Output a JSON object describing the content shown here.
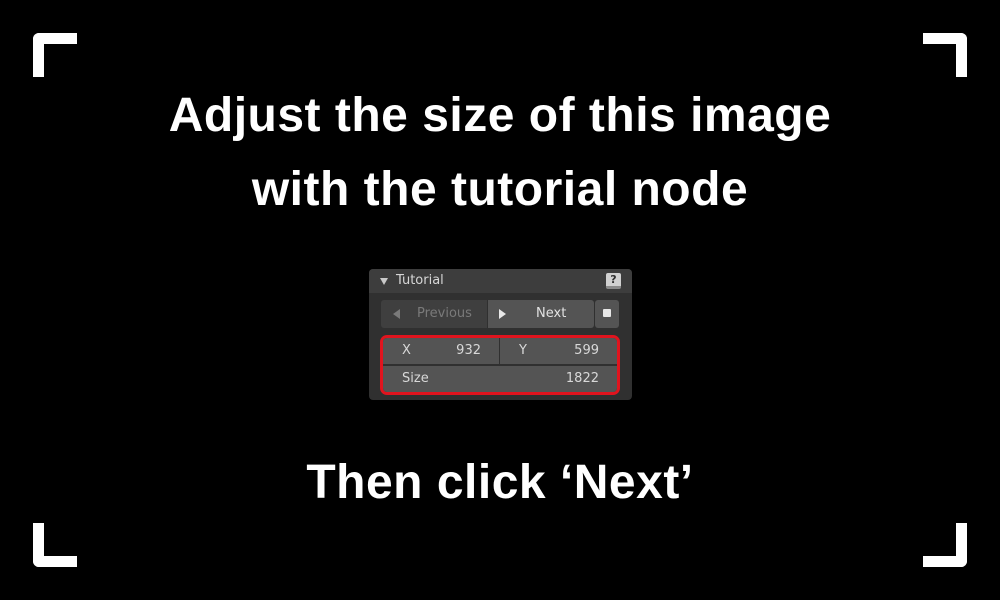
{
  "headline": {
    "line1": "Adjust the size of this image",
    "line2": "with the tutorial node",
    "line3": "Then click ‘Next’"
  },
  "panel": {
    "title": "Tutorial",
    "help_icon_glyph": "?",
    "buttons": {
      "previous_label": "Previous",
      "next_label": "Next"
    },
    "fields": {
      "x_label": "X",
      "x_value": "932",
      "y_label": "Y",
      "y_value": "599",
      "size_label": "Size",
      "size_value": "1822"
    }
  },
  "colors": {
    "background": "#000000",
    "accent_highlight": "#e0141e",
    "panel_bg": "#303030",
    "button_bg": "#545454"
  },
  "icons": [
    "corner-bracket-icon",
    "collapse-triangle-icon",
    "help-book-icon",
    "triangle-left-icon",
    "play-icon",
    "stop-square-icon"
  ]
}
